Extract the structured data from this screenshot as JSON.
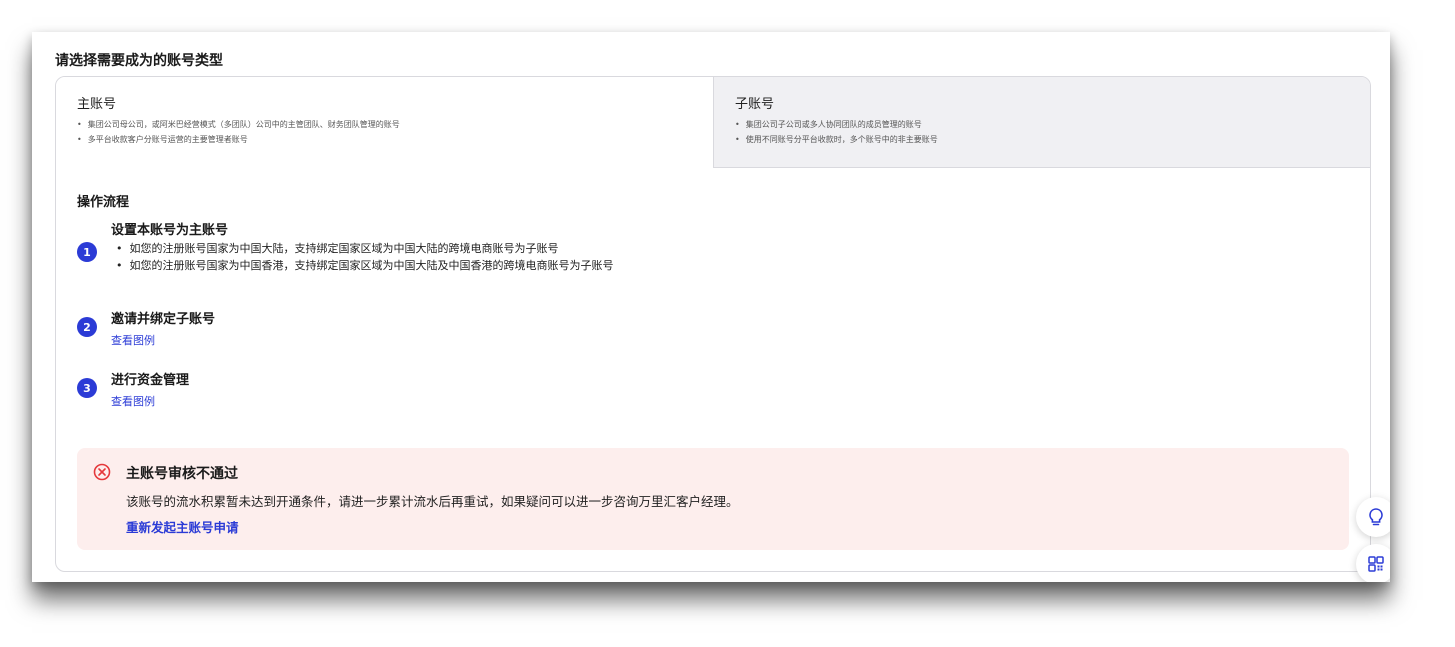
{
  "page": {
    "title": "请选择需要成为的账号类型"
  },
  "account_types": {
    "main": {
      "label": "主账号",
      "bullets": [
        "集团公司母公司，或阿米巴经营模式（多团队）公司中的主管团队、财务团队管理的账号",
        "多平台收款客户分账号运营的主要管理者账号"
      ]
    },
    "sub": {
      "label": "子账号",
      "bullets": [
        "集团公司子公司或多人协同团队的成员管理的账号",
        "使用不同账号分平台收款时，多个账号中的非主要账号"
      ]
    }
  },
  "flow": {
    "title": "操作流程",
    "steps": [
      {
        "num": "1",
        "title": "设置本账号为主账号",
        "bullets": [
          "如您的注册账号国家为中国大陆，支持绑定国家区域为中国大陆的跨境电商账号为子账号",
          "如您的注册账号国家为中国香港，支持绑定国家区域为中国大陆及中国香港的跨境电商账号为子账号"
        ]
      },
      {
        "num": "2",
        "title": "邀请并绑定子账号",
        "link": "查看图例"
      },
      {
        "num": "3",
        "title": "进行资金管理",
        "link": "查看图例"
      }
    ]
  },
  "alert": {
    "icon": "error-circle-icon",
    "title": "主账号审核不通过",
    "description": "该账号的流水积累暂未达到开通条件，请进一步累计流水后再重试，如果疑问可以进一步咨询万里汇客户经理。",
    "action": "重新发起主账号申请"
  },
  "floating": {
    "icons": [
      "lightbulb-icon",
      "qr-code-icon"
    ]
  },
  "colors": {
    "accent": "#2b3bd6",
    "error": "#e5383b",
    "alert_bg": "#fdeeed",
    "sub_tab_bg": "#f0f0f3"
  }
}
